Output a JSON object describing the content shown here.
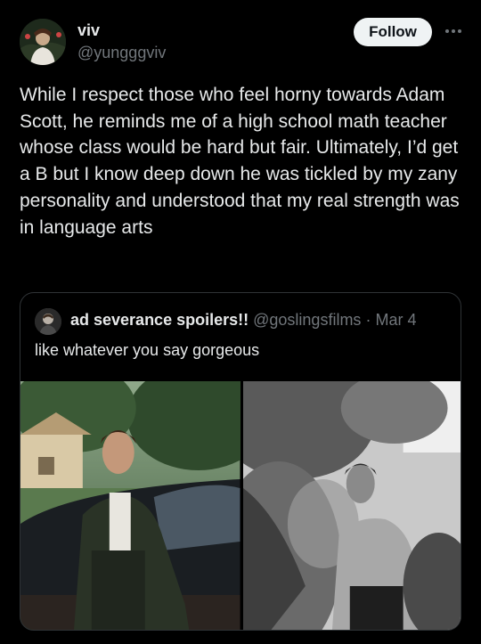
{
  "author": {
    "name": "viv",
    "handle": "@yungggviv"
  },
  "actions": {
    "follow_label": "Follow",
    "more_icon": "more-horizontal-icon"
  },
  "tweet": {
    "text": "While I respect those who feel horny towards Adam Scott, he reminds me of a high school math teacher whose class would be hard but fair. Ultimately, I’d get a B but I know deep down he was tickled by my zany personality and understood that my real strength was in language arts"
  },
  "quoted": {
    "name": "ad severance spoilers!!",
    "handle": "@goslingsfilms",
    "separator": "·",
    "date": "Mar 4",
    "text": "like whatever you say gorgeous",
    "media": [
      "color-photo",
      "bw-photo"
    ]
  },
  "colors": {
    "background": "#000000",
    "text": "#e7e9ea",
    "muted": "#71767b",
    "follow_bg": "#eff3f4",
    "border": "#2f3336"
  }
}
